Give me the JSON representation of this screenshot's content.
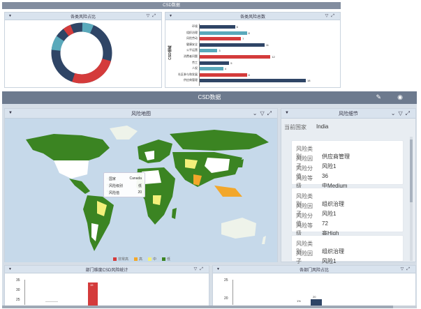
{
  "colors": {
    "accent": "#3a4a66",
    "header_bar": "#6d7a8e",
    "header_bar2": "#828d9f",
    "panel_head": "#d9e3ee",
    "teal": "#5aa9bb",
    "red": "#d43b3b",
    "navy": "#2f4566",
    "map_water": "#c6d9ea",
    "map_land": "#3b8422"
  },
  "top_strip": {
    "title": "CSD数据"
  },
  "donut_panel": {
    "title": "各类风险占比"
  },
  "bar_panel": {
    "title": "各类风险总数",
    "ylabel": "CSD领域",
    "categories": [
      "环境",
      "组织治理",
      "风险劳动",
      "健康安全",
      "公平运营",
      "消费者问题",
      "劳工",
      "人权",
      "社区参与和发展",
      "供应商管理"
    ],
    "values": [
      6,
      8,
      7,
      11,
      3,
      12,
      5,
      4,
      8,
      18
    ],
    "colors": [
      "navy",
      "teal",
      "red",
      "navy",
      "teal",
      "red",
      "navy",
      "teal",
      "red",
      "navy"
    ]
  },
  "main_header": {
    "title": "CSD数据",
    "edit_icon": "edit-icon",
    "eye_icon": "eye-icon"
  },
  "map_panel": {
    "title": "风险地图",
    "tooltip": {
      "k1": "国家",
      "v1": "Canada",
      "k2": "风险级别",
      "v2": "低",
      "k3": "风险值",
      "v3": "20"
    },
    "legend": [
      {
        "label": "非常高",
        "color": "#d43b3b"
      },
      {
        "label": "高",
        "color": "#f2a72b"
      },
      {
        "label": "中",
        "color": "#f3f07a"
      },
      {
        "label": "低",
        "color": "#3b8422"
      }
    ]
  },
  "detail_panel": {
    "title": "风险细节",
    "country_label": "当前国家",
    "country_value": "India",
    "cards": [
      {
        "r1k": "风险类别",
        "r1v": "供应商管理",
        "r2k": "风险因子",
        "r2v": "风险1",
        "r3k": "风险分值",
        "r3v": "36",
        "r4k": "风险等级",
        "r4v": "中Medium"
      },
      {
        "r1k": "风险类别",
        "r1v": "组织治理",
        "r2k": "风险因子",
        "r2v": "风险1",
        "r3k": "风险分值",
        "r3v": "72",
        "r4k": "风险等级",
        "r4v": "高High"
      },
      {
        "r1k": "风险类别",
        "r1v": "组织治理",
        "r2k": "风险因子",
        "r2v": "风险1"
      }
    ]
  },
  "dept_panel": {
    "title": "部门维度CSD风险统计",
    "y_ticks": [
      "35",
      "30",
      "25"
    ],
    "bar_label": "15"
  },
  "dept_share_panel": {
    "title": "各部门风险占比",
    "y_ticks": [
      "25",
      "20"
    ],
    "bar_label": "20",
    "bar_label2": "1%"
  },
  "icons": {
    "filter": "filter-icon",
    "expand": "expand-icon",
    "collapse": "chevron-down-icon"
  }
}
